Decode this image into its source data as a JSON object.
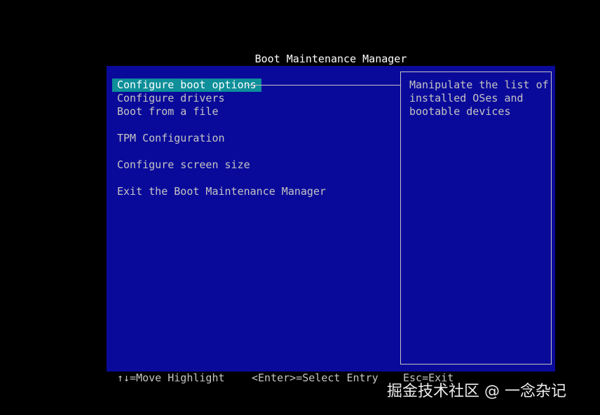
{
  "title": "Boot Maintenance Manager",
  "menu": {
    "items": [
      {
        "label": "Configure boot options",
        "selected": true
      },
      {
        "label": "Configure drivers",
        "selected": false
      },
      {
        "label": "Boot from a file",
        "selected": false
      },
      {
        "label": "TPM Configuration",
        "selected": false
      },
      {
        "label": "Configure screen size",
        "selected": false
      },
      {
        "label": "Exit the Boot Maintenance Manager",
        "selected": false
      }
    ]
  },
  "help": {
    "lines": [
      "Manipulate the list of",
      "installed OSes and",
      "bootable devices"
    ]
  },
  "footer": {
    "move": "↑↓=Move Highlight",
    "select": "<Enter>=Select Entry",
    "exit": "Esc=Exit"
  },
  "watermark": "掘金技术社区 @ 一念杂记",
  "colors": {
    "background": "#000000",
    "panel": "#0a0a9a",
    "highlight": "#0e8f9a",
    "text": "#c4c4c4",
    "title": "#ffffff"
  }
}
